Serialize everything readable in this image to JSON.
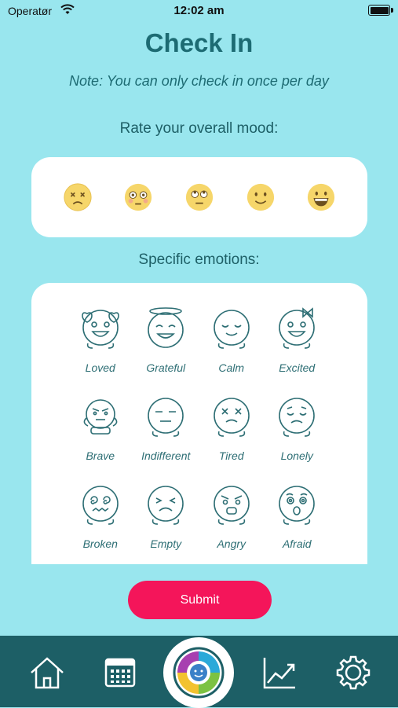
{
  "status_bar": {
    "carrier": "Operatør",
    "time": "12:02 am"
  },
  "header": {
    "title": "Check In",
    "note": "Note: You can only check in once per day"
  },
  "mood": {
    "label": "Rate your overall mood:",
    "options": [
      {
        "name": "very-bad",
        "icon": "dizzy-face-icon"
      },
      {
        "name": "bad",
        "icon": "flushed-face-icon"
      },
      {
        "name": "neutral",
        "icon": "rolling-eyes-face-icon"
      },
      {
        "name": "good",
        "icon": "slight-smile-face-icon"
      },
      {
        "name": "great",
        "icon": "grin-face-icon"
      }
    ]
  },
  "emotions": {
    "label": "Specific emotions:",
    "items": [
      {
        "label": "Loved"
      },
      {
        "label": "Grateful"
      },
      {
        "label": "Calm"
      },
      {
        "label": "Excited"
      },
      {
        "label": "Brave"
      },
      {
        "label": "Indifferent"
      },
      {
        "label": "Tired"
      },
      {
        "label": "Lonely"
      },
      {
        "label": "Broken"
      },
      {
        "label": "Empty"
      },
      {
        "label": "Angry"
      },
      {
        "label": "Afraid"
      }
    ]
  },
  "submit_label": "Submit",
  "tabs": [
    {
      "name": "home",
      "icon": "home-icon"
    },
    {
      "name": "calendar",
      "icon": "calendar-icon"
    },
    {
      "name": "check-in",
      "icon": "mood-wheel-icon"
    },
    {
      "name": "trends",
      "icon": "chart-icon"
    },
    {
      "name": "settings",
      "icon": "gear-icon"
    }
  ],
  "colors": {
    "background": "#99e6ee",
    "accent": "#f4155a",
    "tabbar": "#1d5f66",
    "text": "#1d6b73"
  }
}
